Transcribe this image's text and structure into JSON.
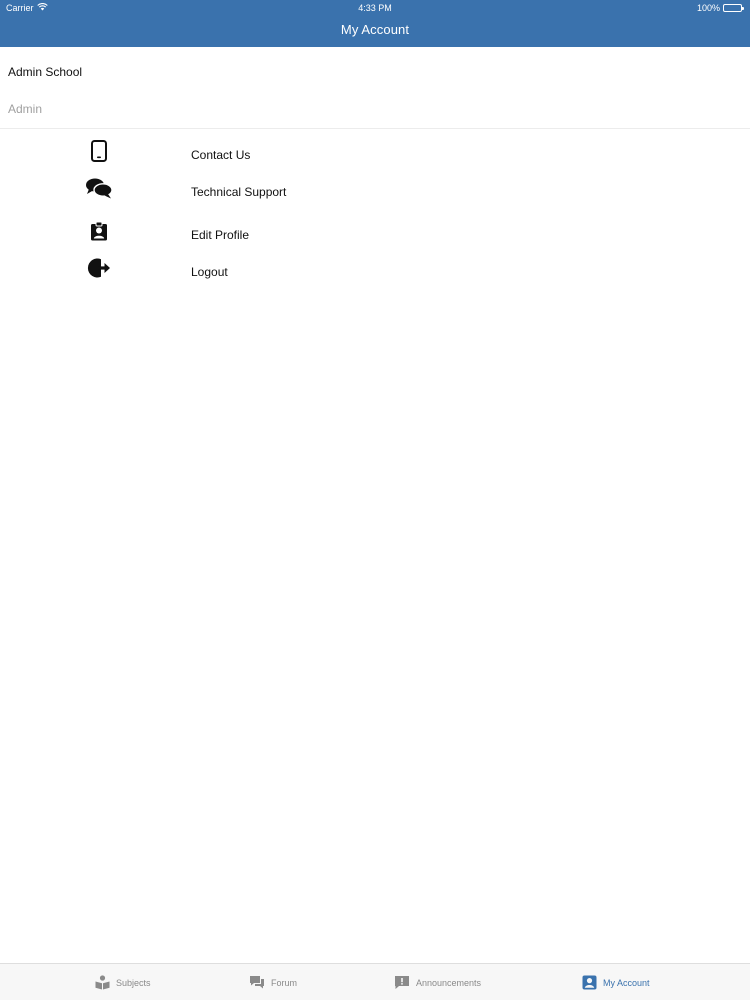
{
  "status_bar": {
    "carrier": "Carrier",
    "time": "4:33 PM",
    "battery": "100%"
  },
  "header": {
    "title": "My Account",
    "color": "#3a72ad"
  },
  "profile": {
    "school": "Admin School",
    "role": "Admin"
  },
  "menu": {
    "items": [
      {
        "label": "Contact Us",
        "icon": "mobile-phone-icon"
      },
      {
        "label": "Technical Support",
        "icon": "chat-bubbles-icon"
      },
      {
        "label": "Edit Profile",
        "icon": "id-badge-icon"
      },
      {
        "label": "Logout",
        "icon": "logout-icon"
      }
    ]
  },
  "tabbar": {
    "tabs": [
      {
        "label": "Subjects",
        "icon": "book-reader-icon",
        "active": false
      },
      {
        "label": "Forum",
        "icon": "forum-icon",
        "active": false
      },
      {
        "label": "Announcements",
        "icon": "announcement-icon",
        "active": false
      },
      {
        "label": "My Account",
        "icon": "account-icon",
        "active": true
      }
    ],
    "active_color": "#3a72ad",
    "inactive_color": "#8a8a8a"
  }
}
